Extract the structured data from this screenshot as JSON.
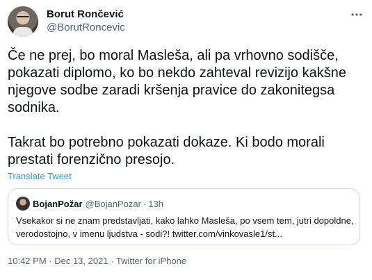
{
  "author": {
    "display_name": "Borut Rončević",
    "handle": "@BorutRoncevic"
  },
  "more_icon": "ellipsis-icon",
  "tweet_text": "Če ne prej, bo moral Masleša, ali pa vrhovno sodišče,\npokazati diplomo, ko bo nekdo zahteval revizijo kakšne\nnjegove sodbe zaradi kršenja pravice do zakonitegsa\nsodnika.\n\nTakrat bo potrebno pokazati dokaze. Ki bodo morali\nprestati forenzično presojo.",
  "translate_label": "Translate Tweet",
  "quoted": {
    "display_name": "BojanPožar",
    "handle": "@BojanPozar",
    "separator": "·",
    "time": "13h",
    "text": "Vsekakor si ne znam predstavljati, kako lahko Masleša, po vsem tem, jutri dopoldne, verodostojno, v imenu ljudstva - sodi?! twitter.com/vinkovasle1/st..."
  },
  "meta": {
    "time": "10:42 PM",
    "sep1": " · ",
    "date": "Dec 13, 2021",
    "sep2": " · ",
    "source": "Twitter for iPhone"
  },
  "colors": {
    "accent": "#1d9bf0",
    "text": "#0f1419",
    "secondary": "#536471",
    "border": "#cfd9de"
  }
}
